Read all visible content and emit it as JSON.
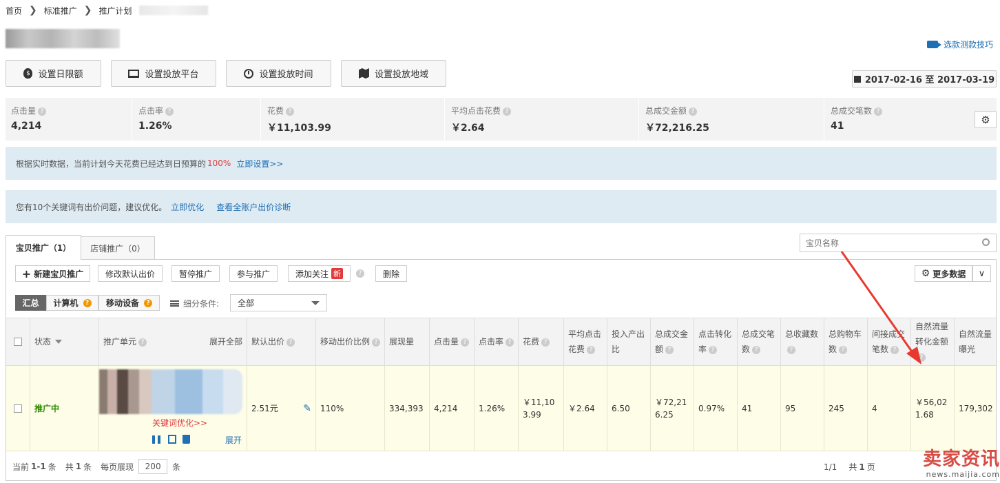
{
  "breadcrumb": {
    "home": "首页",
    "standard": "标准推广",
    "plan": "推广计划"
  },
  "header": {
    "tips_link": "选款测款技巧",
    "date_range": "2017-02-16 至 2017-03-19"
  },
  "toolbar": {
    "daily_limit": "设置日限额",
    "platform": "设置投放平台",
    "time": "设置投放时间",
    "region": "设置投放地域"
  },
  "stats": [
    {
      "label": "点击量",
      "value": "4,214"
    },
    {
      "label": "点击率",
      "value": "1.26%"
    },
    {
      "label": "花费",
      "value": "￥11,103.99"
    },
    {
      "label": "平均点击花费",
      "value": "￥2.64"
    },
    {
      "label": "总成交金额",
      "value": "￥72,216.25"
    },
    {
      "label": "总成交笔数",
      "value": "41"
    }
  ],
  "notice1": {
    "text": "根据实时数据，当前计划今天花费已经达到日预算的",
    "percent": "100%",
    "link": "立即设置>>"
  },
  "notice2": {
    "text": "您有10个关键词有出价问题，建议优化。",
    "link1": "立即优化",
    "link2": "查看全账户出价诊断"
  },
  "tabs": {
    "item": "宝贝推广（1）",
    "shop": "店铺推广（0）"
  },
  "search": {
    "placeholder": "宝贝名称"
  },
  "actions": {
    "new": "新建宝贝推广",
    "modify_bid": "修改默认出价",
    "pause": "暂停推广",
    "join": "参与推广",
    "follow": "添加关注",
    "new_badge": "新",
    "delete": "删除",
    "more_data": "更多数据"
  },
  "filters": {
    "summary": "汇总",
    "computer": "计算机",
    "mobile": "移动设备",
    "detail_label": "细分条件:",
    "detail_value": "全部"
  },
  "table": {
    "headers": {
      "status": "状态",
      "unit": "推广单元",
      "expand_all": "展开全部",
      "default_bid": "默认出价",
      "mobile_ratio": "移动出价比例",
      "impressions": "展现量",
      "clicks": "点击量",
      "ctr": "点击率",
      "cost": "花费",
      "avg_cpc": "平均点击花费",
      "roi": "投入产出比",
      "total_gmv": "总成交金额",
      "conv_rate": "点击转化率",
      "total_orders": "总成交笔数",
      "favorites": "总收藏数",
      "carts": "总购物车数",
      "indirect_orders": "间接成交笔数",
      "natural_gmv": "自然流量转化金额",
      "natural_exposure": "自然流量曝光"
    },
    "row": {
      "status": "推广中",
      "keyword_link": "关键词优化>>",
      "expand": "展开",
      "default_bid": "2.51元",
      "mobile_ratio": "110%",
      "impressions": "334,393",
      "clicks": "4,214",
      "ctr": "1.26%",
      "cost": "￥11,103.99",
      "avg_cpc": "￥2.64",
      "roi": "6.50",
      "total_gmv": "￥72,216.25",
      "conv_rate": "0.97%",
      "total_orders": "41",
      "favorites": "95",
      "carts": "245",
      "indirect_orders": "4",
      "natural_gmv": "￥56,021.68",
      "natural_exposure": "179,302"
    }
  },
  "pagination": {
    "current_label": "当前",
    "current_range": "1-1",
    "current_unit": "条",
    "total_label": "共",
    "total_count": "1",
    "total_unit": "条",
    "per_page_label": "每页展现",
    "per_page_value": "200",
    "per_page_unit": "条",
    "pages": "1/1",
    "total_pages_label": "共",
    "total_pages": "1",
    "total_pages_unit": "页"
  },
  "watermark": {
    "brand": "卖家资讯",
    "url": "news.maijia.com"
  },
  "colors": {
    "accent": "#1f6fb5",
    "status_green": "#2e8b00",
    "red": "#e03a3a",
    "arrow": "#e8392f"
  }
}
